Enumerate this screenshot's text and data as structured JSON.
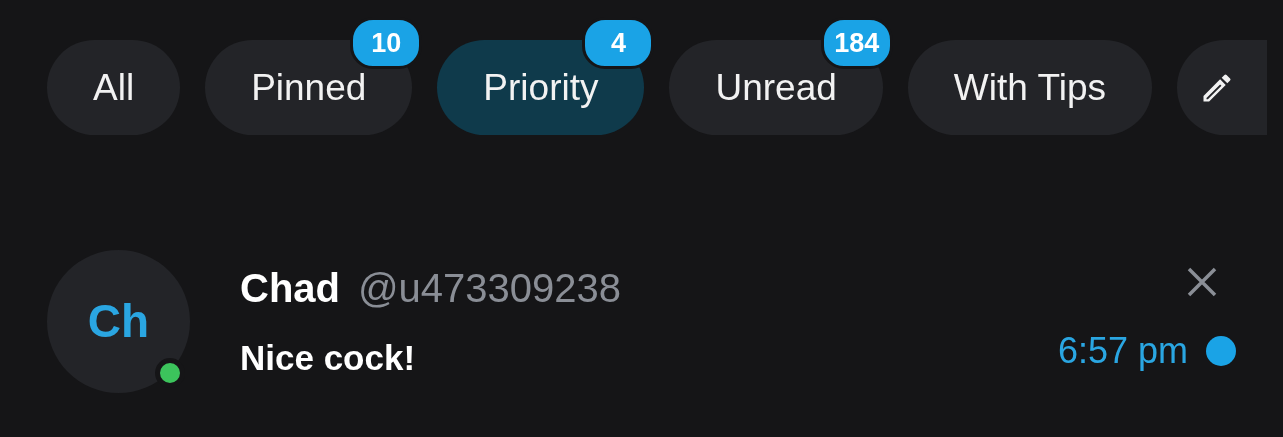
{
  "filters": [
    {
      "label": "All",
      "selected": false
    },
    {
      "label": "Pinned",
      "selected": false,
      "badge": "10"
    },
    {
      "label": "Priority",
      "selected": true,
      "badge": "4"
    },
    {
      "label": "Unread",
      "selected": false,
      "badge": "184"
    },
    {
      "label": "With Tips",
      "selected": false
    }
  ],
  "chats": [
    {
      "initials": "Ch",
      "online": true,
      "name": "Chad",
      "handle": "@u473309238",
      "message": "Nice cock!",
      "time": "6:57 pm",
      "unread": true
    }
  ]
}
